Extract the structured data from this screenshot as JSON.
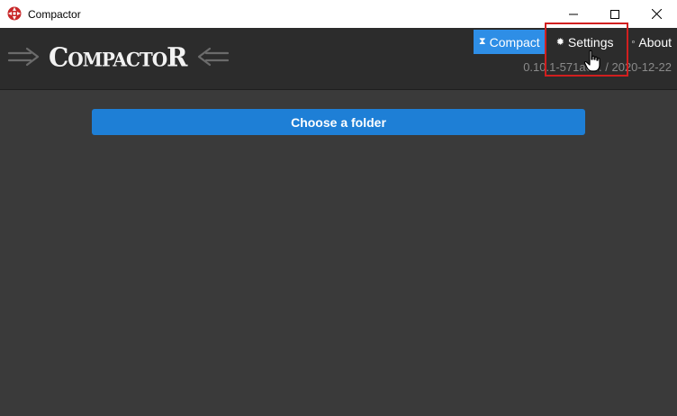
{
  "window": {
    "title": "Compactor",
    "app_icon": "compactor-logo-icon",
    "controls": [
      "minimize-icon",
      "maximize-icon",
      "close-icon"
    ]
  },
  "header": {
    "logo_text": "CompactoR",
    "nav": [
      {
        "label": "Compact",
        "icon": "hourglass-icon",
        "active": true
      },
      {
        "label": "Settings",
        "icon": "gear-icon",
        "active": false
      },
      {
        "label": "About",
        "icon": "info-icon",
        "active": false
      }
    ],
    "version": "0.10.1-571a6... / 2020-12-22"
  },
  "main": {
    "choose_folder_label": "Choose a folder"
  },
  "colors": {
    "accent": "#2e8ee6",
    "button": "#1e7fd6",
    "highlight": "#d11f1f",
    "background": "#3a3a3a",
    "header_bg": "#2c2c2c"
  }
}
